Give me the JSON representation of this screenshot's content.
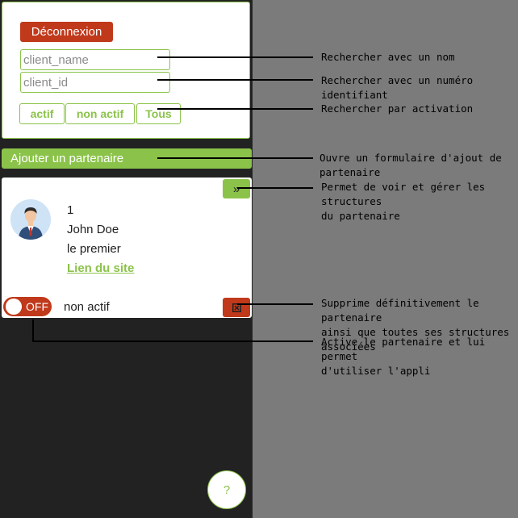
{
  "logout": {
    "label": "Déconnexion"
  },
  "search": {
    "name_placeholder": "client_name",
    "id_placeholder": "client_id"
  },
  "filters": [
    {
      "label": "actif"
    },
    {
      "label": "non actif"
    },
    {
      "label": "Tous"
    }
  ],
  "add_partner": {
    "label": "Ajouter un partenaire"
  },
  "partner": {
    "id": "1",
    "name": "John Doe",
    "description": "le premier",
    "link_label": "Lien du site",
    "toggle_label": "OFF",
    "status": "non actif",
    "expand_icon": "double-chevron-right-icon",
    "delete_icon": "close-box-icon"
  },
  "help": {
    "label": "?"
  },
  "annotations": {
    "search_name": "Rechercher avec un nom",
    "search_id": "Rechercher avec un numéro identifiant",
    "filter": "Rechercher par activation",
    "add_form": "Ouvre un formulaire d'ajout de partenaire",
    "structures": "Permet de voir et gérer les structures\ndu partenaire",
    "delete": "Supprime définitivement le partenaire\nainsi que toutes ses structures associées",
    "activate": "Active le partenaire et lui permet\nd'utiliser l'appli"
  },
  "colors": {
    "accent": "#8bc34a",
    "danger": "#c0391b",
    "sidebar_bg": "#222222",
    "overlay_bg": "#7b7b7b"
  }
}
